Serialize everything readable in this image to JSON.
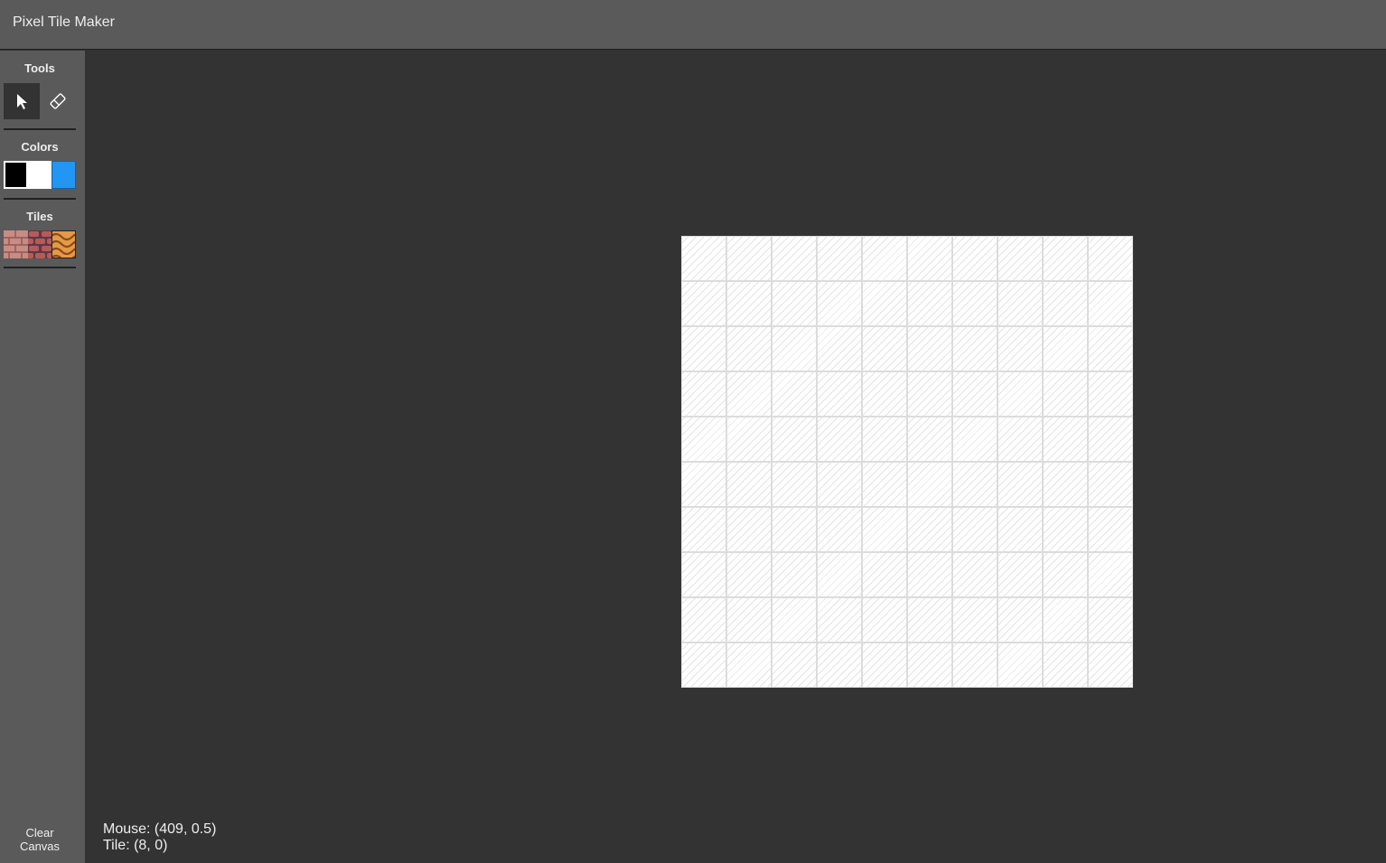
{
  "app": {
    "title": "Pixel Tile Maker"
  },
  "sidebar": {
    "tools_label": "Tools",
    "tools": [
      {
        "name": "pointer",
        "icon": "cursor-arrow-icon",
        "selected": true
      },
      {
        "name": "eraser",
        "icon": "eraser-icon",
        "selected": false
      }
    ],
    "colors_label": "Colors",
    "colors": [
      "#000000",
      "#ffffff",
      "#2196f3"
    ],
    "tiles_label": "Tiles",
    "tiles": [
      {
        "name": "pink-brick",
        "colors": [
          "#c98b84",
          "#8e5b55"
        ]
      },
      {
        "name": "red-brick",
        "colors": [
          "#b95a58",
          "#5a3a4a"
        ]
      },
      {
        "name": "orange-wave",
        "colors": [
          "#e59a45",
          "#8a4a20"
        ]
      }
    ],
    "clear_label_line1": "Clear",
    "clear_label_line2": "Canvas"
  },
  "canvas": {
    "rows": 10,
    "cols": 10,
    "background": "#ffffff",
    "grid_color": "#dcdcdc"
  },
  "status": {
    "mouse": "Mouse: (409, 0.5)",
    "tile": "Tile: (8, 0)"
  }
}
